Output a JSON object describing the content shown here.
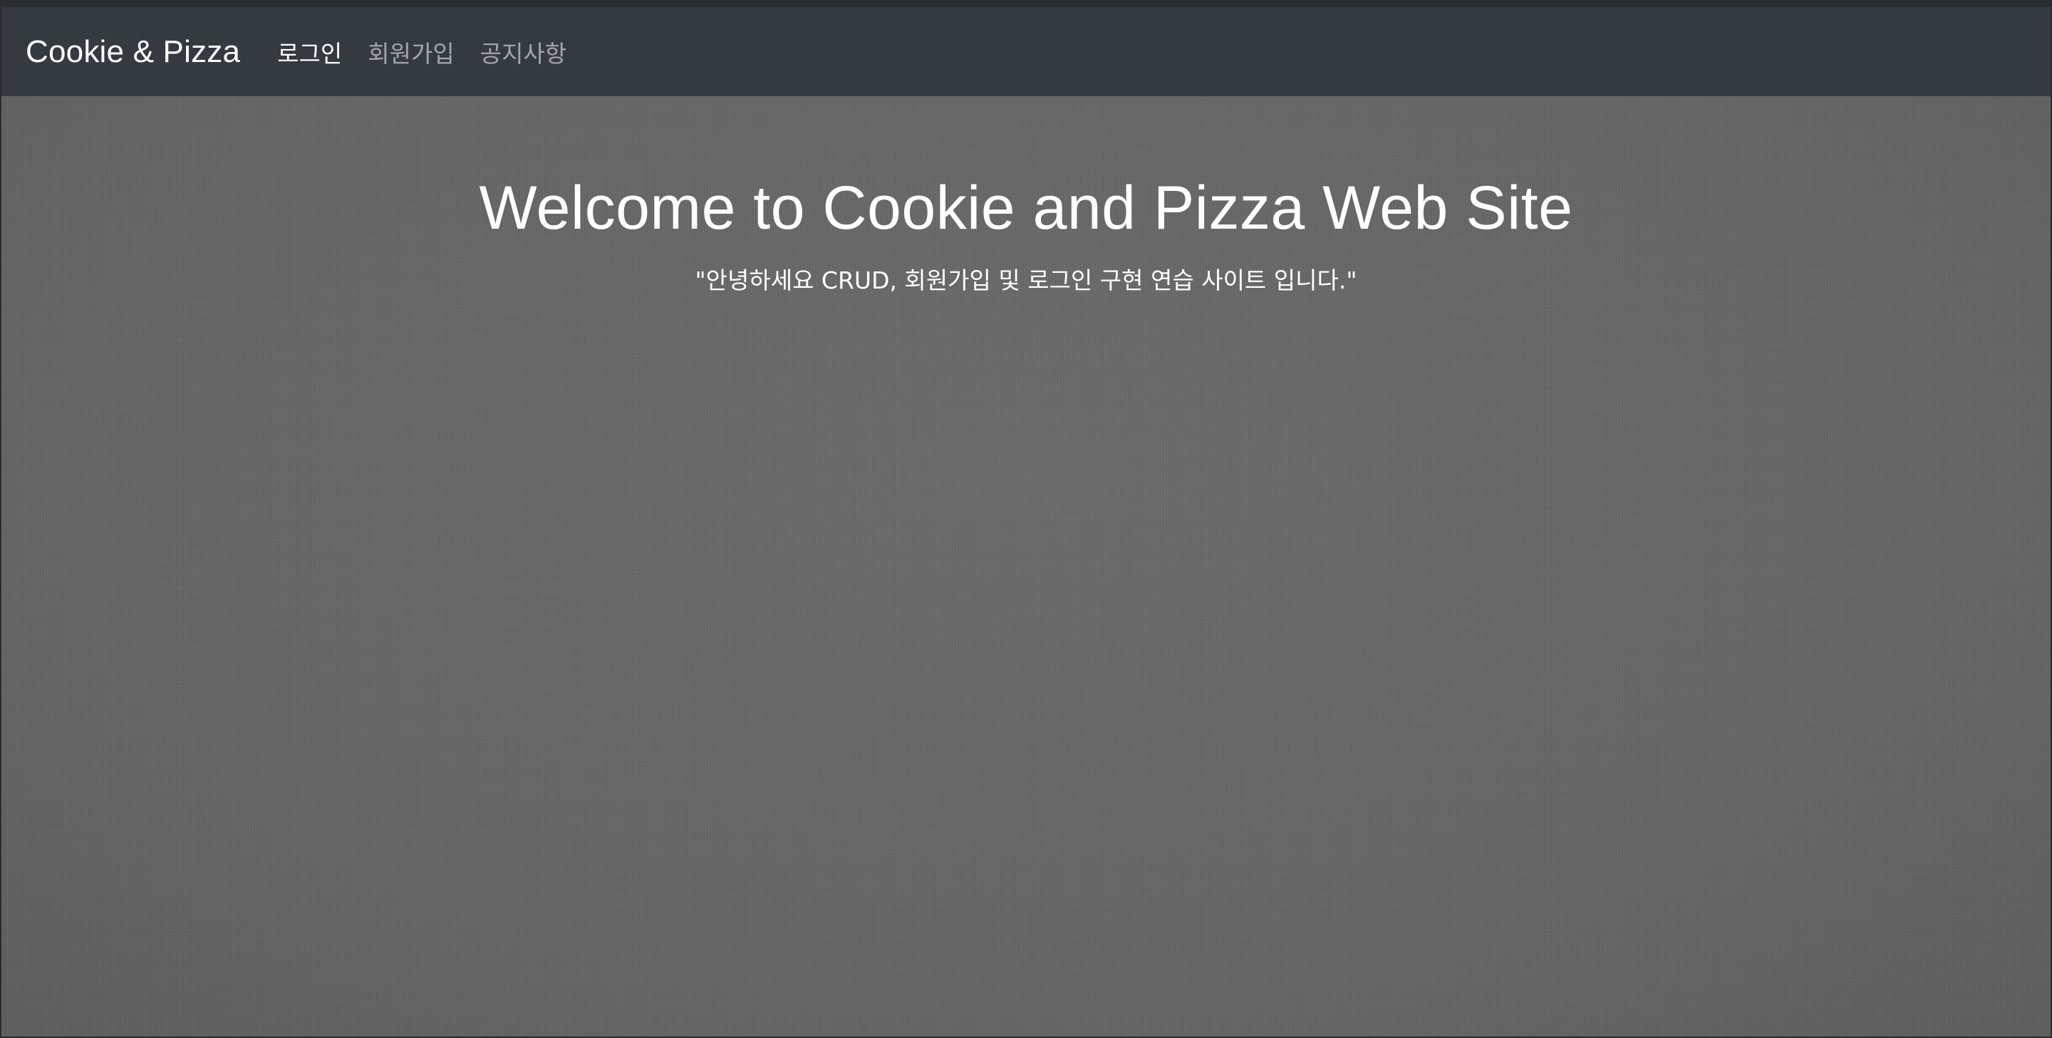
{
  "navbar": {
    "brand": "Cookie & Pizza",
    "links": [
      {
        "label": "로그인",
        "active": true
      },
      {
        "label": "회원가입",
        "active": false
      },
      {
        "label": "공지사항",
        "active": false
      }
    ]
  },
  "hero": {
    "title": "Welcome to Cookie and Pizza Web Site",
    "subtitle": "\"안녕하세요 CRUD, 회원가입 및 로그인 구현 연습 사이트 입니다.\""
  },
  "colors": {
    "navbar_bg": "#343a40",
    "hero_bg": "#666666",
    "text_primary": "#ffffff"
  }
}
